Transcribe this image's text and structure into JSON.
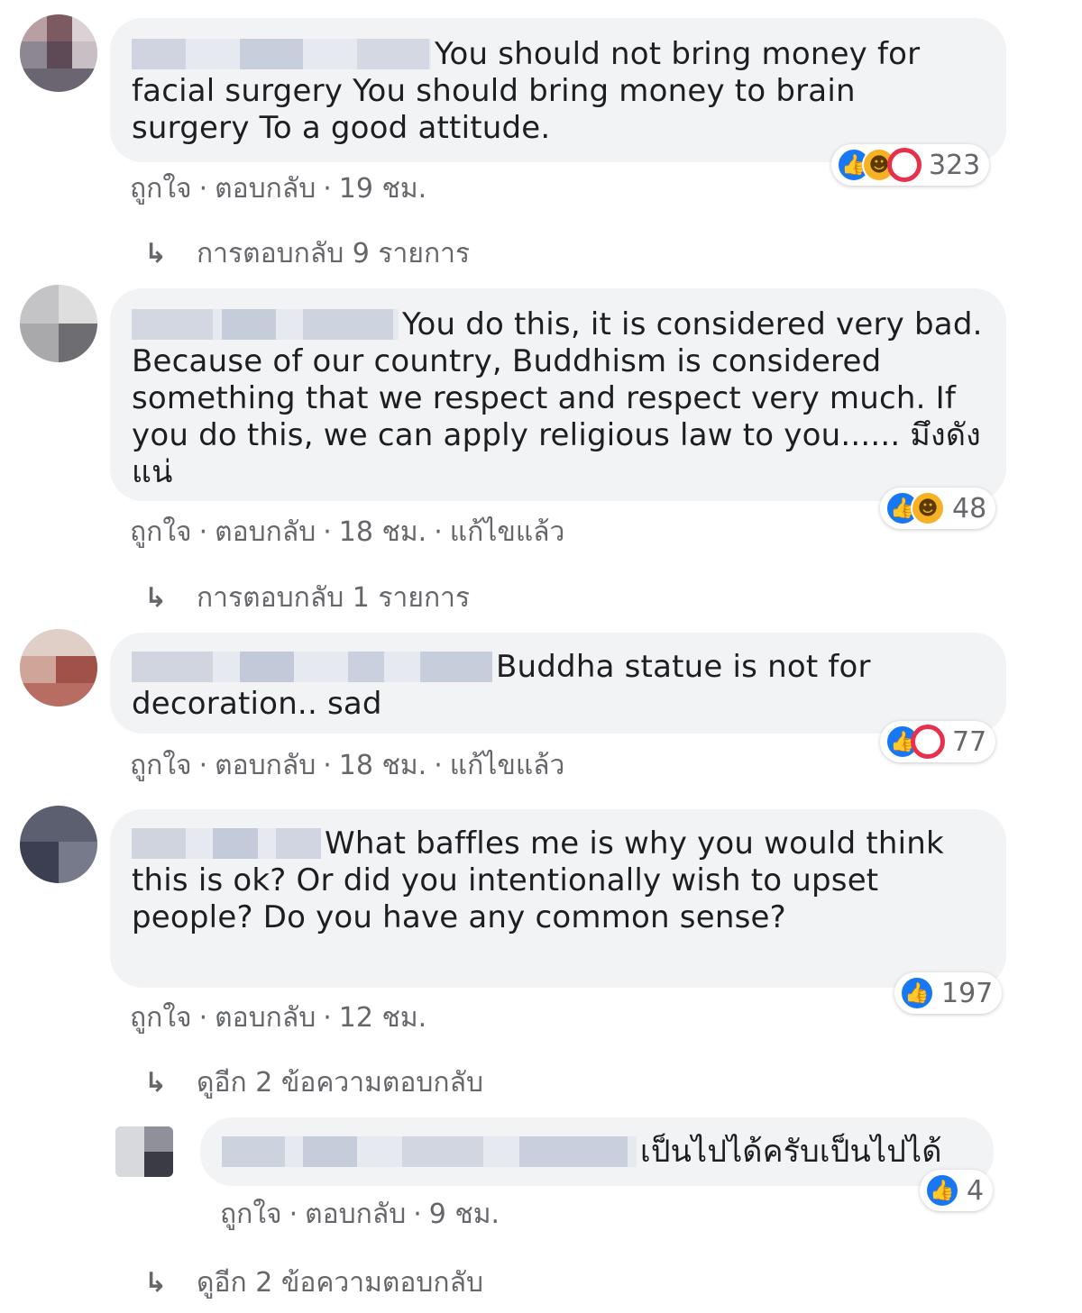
{
  "comments": [
    {
      "text": "You should not bring money for facial surgery You should bring money to brain surgery To a good attitude.",
      "like_label": "ถูกใจ",
      "reply_label": "ตอบกลับ",
      "time": "19 ชม.",
      "edited": "",
      "reactions": [
        "like-icon",
        "haha-icon",
        "sad-icon"
      ],
      "reaction_count": "323",
      "replies_link": "การตอบกลับ 9 รายการ"
    },
    {
      "text": "You do this, it is considered very bad. Because of our country, Buddhism is considered something that we respect and respect very much. If you do this, we can apply religious law to you...... มึงดังแน่",
      "like_label": "ถูกใจ",
      "reply_label": "ตอบกลับ",
      "time": "18 ชม.",
      "edited": "แก้ไขแล้ว",
      "reactions": [
        "like-icon",
        "haha-icon"
      ],
      "reaction_count": "48",
      "replies_link": "การตอบกลับ 1 รายการ"
    },
    {
      "text": "Buddha statue is not for decoration.. sad",
      "like_label": "ถูกใจ",
      "reply_label": "ตอบกลับ",
      "time": "18 ชม.",
      "edited": "แก้ไขแล้ว",
      "reactions": [
        "like-icon",
        "sad-icon"
      ],
      "reaction_count": "77",
      "replies_link": ""
    },
    {
      "text": "What baffles me is why you would think this is ok? Or did you intentionally wish to upset people? Do you have any common sense?",
      "like_label": "ถูกใจ",
      "reply_label": "ตอบกลับ",
      "time": "12 ชม.",
      "edited": "",
      "reactions": [
        "like-icon"
      ],
      "reaction_count": "197",
      "replies_link": "ดูอีก 2 ข้อความตอบกลับ"
    }
  ],
  "reply": {
    "text": "เป็นไปได้ครับเป็นไปได้",
    "like_label": "ถูกใจ",
    "reply_label": "ตอบกลับ",
    "time": "9 ชม.",
    "reactions": [
      "like-icon"
    ],
    "reaction_count": "4"
  },
  "more_replies_link": "ดูอีก 2 ข้อความตอบกลับ",
  "colors": {
    "bubble": "#f2f3f5",
    "meta_text": "#65676b",
    "like_blue": "#1877f2",
    "sad_red": "#e9304a",
    "haha_yellow": "#f7b125"
  }
}
